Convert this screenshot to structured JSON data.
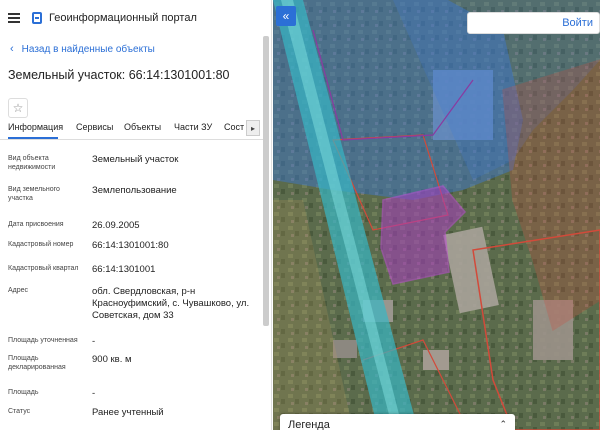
{
  "app": {
    "title": "Геоинформационный портал"
  },
  "nav": {
    "back_label": "Назад в найденные объекты"
  },
  "object": {
    "title": "Земельный участок: 66:14:1301001:80"
  },
  "tabs": [
    {
      "label": "Информация",
      "active": true
    },
    {
      "label": "Сервисы",
      "active": false
    },
    {
      "label": "Объекты",
      "active": false
    },
    {
      "label": "Части ЗУ",
      "active": false
    },
    {
      "label": "Сост",
      "active": false
    }
  ],
  "properties": [
    {
      "label": "Вид объекта недвижимости",
      "value": "Земельный участок"
    },
    {
      "label": "Вид земельного участка",
      "value": "Землепользование"
    },
    {
      "label": "Дата присвоения",
      "value": "26.09.2005"
    },
    {
      "label": "Кадастровый номер",
      "value": "66:14:1301001:80"
    },
    {
      "label": "Кадастровый квартал",
      "value": "66:14:1301001"
    },
    {
      "label": "Адрес",
      "value": "обл. Свердловская, р-н Красноуфимский, с. Чувашково, ул. Советская, дом 33"
    },
    {
      "label": "Площадь уточненная",
      "value": "-"
    },
    {
      "label": "Площадь декларированная",
      "value": "900 кв. м"
    },
    {
      "label": "Площадь",
      "value": "-"
    },
    {
      "label": "Статус",
      "value": "Ранее учтенный"
    }
  ],
  "map": {
    "login_label": "Войти",
    "legend_label": "Легенда",
    "collapse_icon": "double-chevron-left-icon",
    "colors": {
      "road": "#38b6c4",
      "zone_blue": "#3a78d6",
      "parcel_red": "#d24a3a",
      "parcel_selected": "#a83cc0"
    }
  }
}
